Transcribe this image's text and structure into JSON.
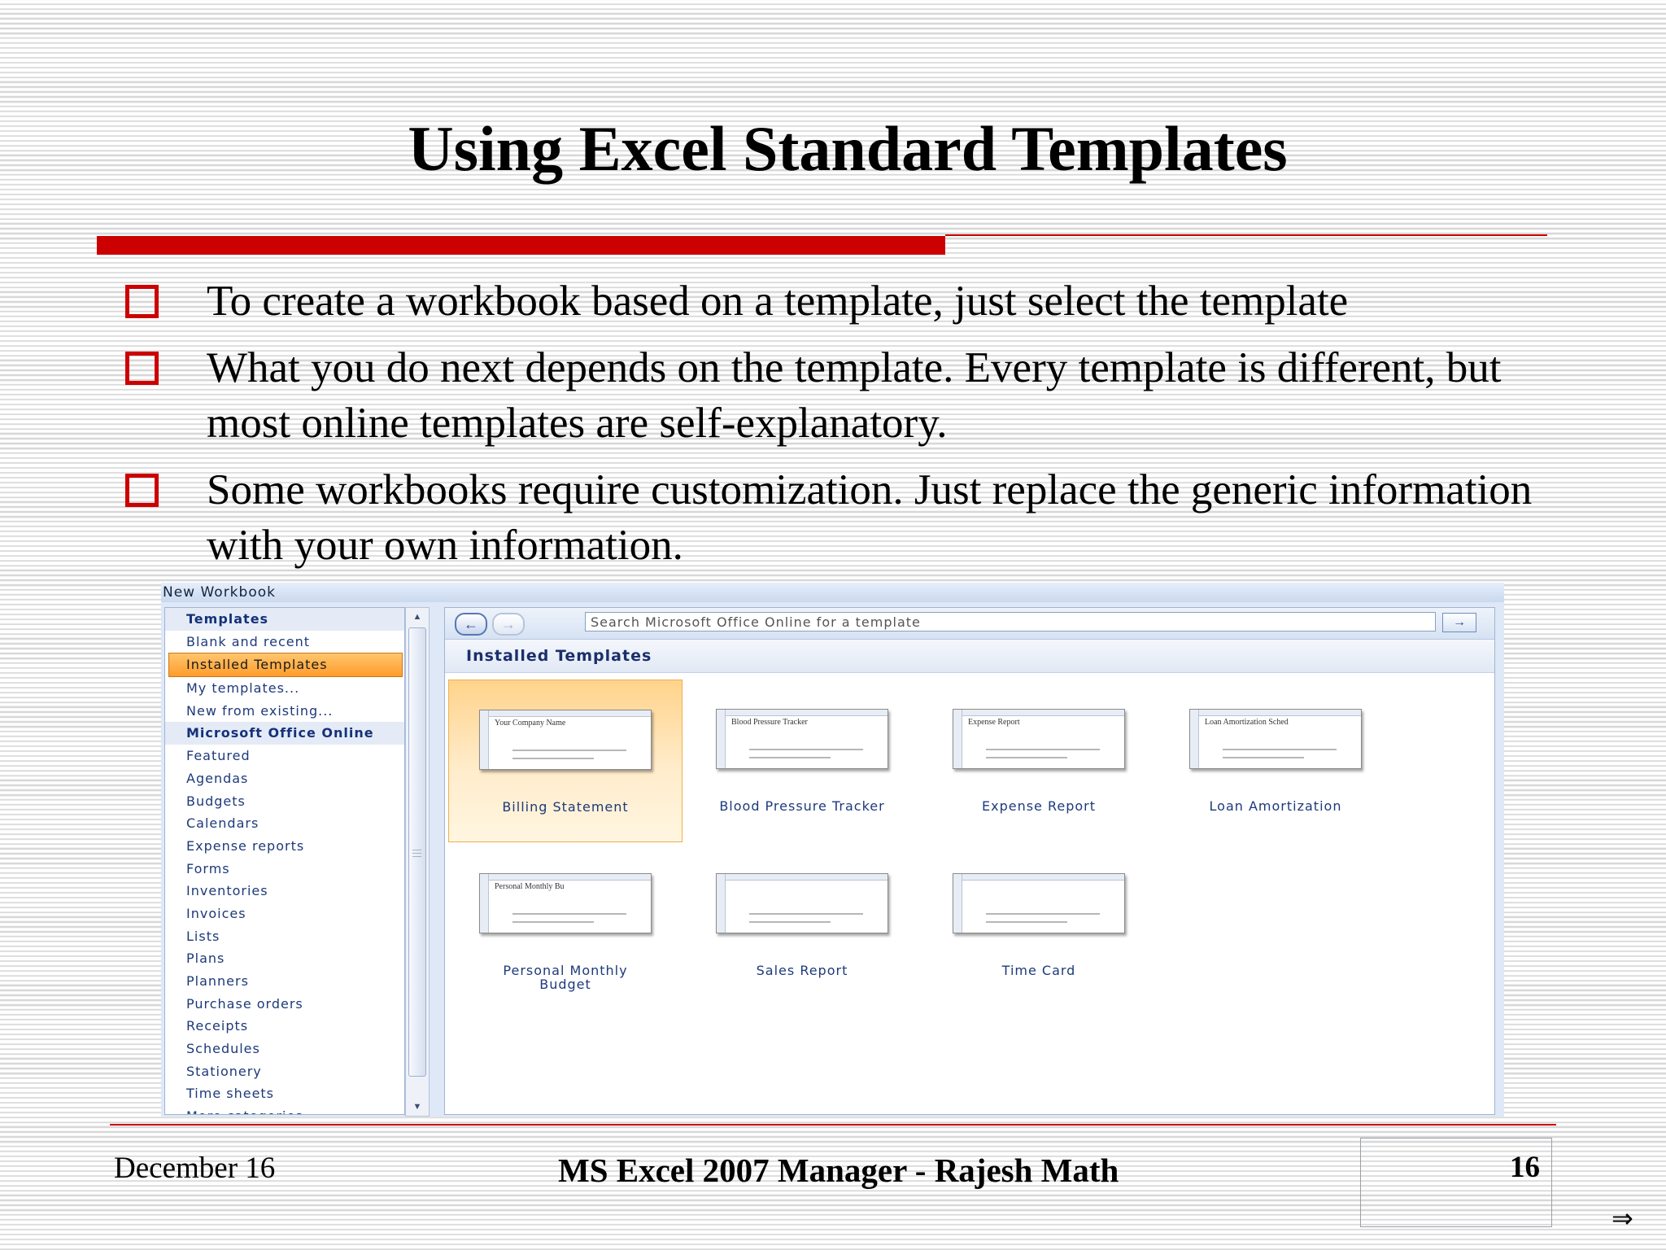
{
  "slide": {
    "title": "Using Excel Standard Templates",
    "bullets": [
      "To create a workbook based on a template, just select the template",
      "What you do next depends on the template. Every template is different, but most online templates are self-explanatory.",
      "Some workbooks require customization. Just replace the generic information with your own information."
    ]
  },
  "dialog": {
    "title": "New Workbook",
    "nav": [
      {
        "label": "Templates",
        "type": "header"
      },
      {
        "label": "Blank and recent",
        "type": "item"
      },
      {
        "label": "Installed Templates",
        "type": "selected"
      },
      {
        "label": "My templates...",
        "type": "item"
      },
      {
        "label": "New from existing...",
        "type": "item"
      },
      {
        "label": "Microsoft Office Online",
        "type": "header"
      },
      {
        "label": "Featured",
        "type": "item"
      },
      {
        "label": "Agendas",
        "type": "item"
      },
      {
        "label": "Budgets",
        "type": "item"
      },
      {
        "label": "Calendars",
        "type": "item"
      },
      {
        "label": "Expense reports",
        "type": "item"
      },
      {
        "label": "Forms",
        "type": "item"
      },
      {
        "label": "Inventories",
        "type": "item"
      },
      {
        "label": "Invoices",
        "type": "item"
      },
      {
        "label": "Lists",
        "type": "item"
      },
      {
        "label": "Plans",
        "type": "item"
      },
      {
        "label": "Planners",
        "type": "item"
      },
      {
        "label": "Purchase orders",
        "type": "item"
      },
      {
        "label": "Receipts",
        "type": "item"
      },
      {
        "label": "Schedules",
        "type": "item"
      },
      {
        "label": "Stationery",
        "type": "item"
      },
      {
        "label": "Time sheets",
        "type": "item"
      },
      {
        "label": "More categories",
        "type": "item"
      }
    ],
    "search_placeholder": "Search Microsoft Office Online for a template",
    "section_title": "Installed Templates",
    "templates": [
      {
        "label": "Billing Statement",
        "thumb_text": "Your Company Name",
        "selected": true
      },
      {
        "label": "Blood Pressure Tracker",
        "thumb_text": "Blood Pressure Tracker",
        "selected": false
      },
      {
        "label": "Expense Report",
        "thumb_text": "Expense Report",
        "selected": false
      },
      {
        "label": "Loan Amortization",
        "thumb_text": "Loan Amortization Sched",
        "selected": false
      },
      {
        "label": "Personal Monthly Budget",
        "thumb_text": "Personal Monthly Bu",
        "selected": false
      },
      {
        "label": "Sales Report",
        "thumb_text": "",
        "selected": false
      },
      {
        "label": "Time Card",
        "thumb_text": "",
        "selected": false
      }
    ]
  },
  "footer": {
    "date": "December 16",
    "center": "MS Excel 2007 Manager - Rajesh Math",
    "page": "16",
    "next_arrow": "⇒"
  },
  "colors": {
    "accent_red": "#cc0000",
    "selection_orange": "#ff9c2a",
    "link_blue": "#1d3a7a"
  }
}
